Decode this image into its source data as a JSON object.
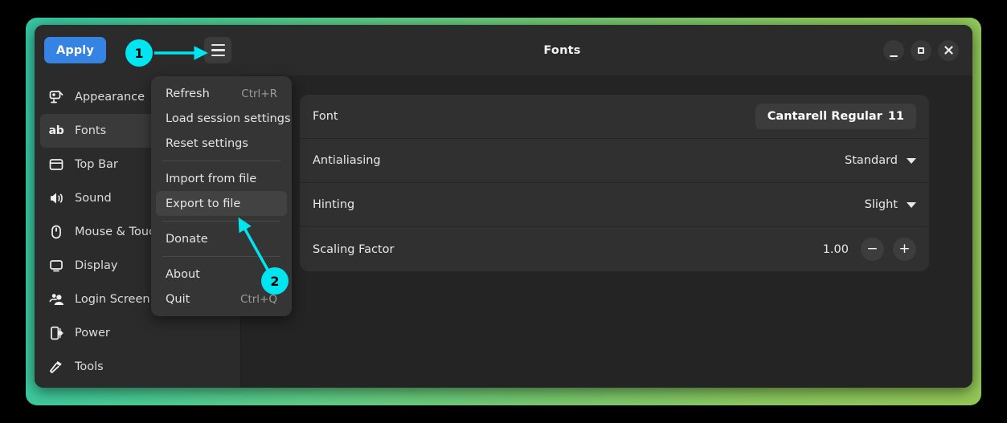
{
  "window": {
    "title": "Fonts",
    "controls": [
      {
        "name": "minimize",
        "glyph": "–"
      },
      {
        "name": "maximize",
        "glyph": "□"
      },
      {
        "name": "close",
        "glyph": "✕"
      }
    ]
  },
  "header": {
    "apply_label": "Apply",
    "menu_button_name": "hamburger-menu-icon"
  },
  "sidebar": {
    "items": [
      {
        "label": "Appearance",
        "icon": "appearance-icon",
        "selected": false
      },
      {
        "label": "Fonts",
        "icon": "ab-text-icon",
        "selected": true
      },
      {
        "label": "Top Bar",
        "icon": "top-bar-icon",
        "selected": false
      },
      {
        "label": "Sound",
        "icon": "speaker-icon",
        "selected": false
      },
      {
        "label": "Mouse & Touchpad",
        "icon": "mouse-icon",
        "selected": false
      },
      {
        "label": "Display",
        "icon": "monitor-icon",
        "selected": false
      },
      {
        "label": "Login Screen",
        "icon": "people-icon",
        "selected": false
      },
      {
        "label": "Power",
        "icon": "power-plug-icon",
        "selected": false
      },
      {
        "label": "Tools",
        "icon": "hammer-icon",
        "selected": false
      }
    ]
  },
  "menu": {
    "groups": [
      {
        "items": [
          {
            "label": "Refresh",
            "accel": "Ctrl+R",
            "highlighted": false
          },
          {
            "label": "Load session settings",
            "accel": "",
            "highlighted": false
          },
          {
            "label": "Reset settings",
            "accel": "",
            "highlighted": false
          }
        ]
      },
      {
        "items": [
          {
            "label": "Import from file",
            "accel": "",
            "highlighted": false
          },
          {
            "label": "Export to file",
            "accel": "",
            "highlighted": true
          }
        ]
      },
      {
        "items": [
          {
            "label": "Donate",
            "accel": "",
            "highlighted": false
          }
        ]
      },
      {
        "items": [
          {
            "label": "About",
            "accel": "",
            "highlighted": false
          },
          {
            "label": "Quit",
            "accel": "Ctrl+Q",
            "highlighted": false
          }
        ]
      }
    ]
  },
  "preferences": {
    "font": {
      "label": "Font",
      "family": "Cantarell Regular",
      "size": "11"
    },
    "antialiasing": {
      "label": "Antialiasing",
      "value": "Standard"
    },
    "hinting": {
      "label": "Hinting",
      "value": "Slight"
    },
    "scaling_factor": {
      "label": "Scaling Factor",
      "value": "1.00",
      "decrement": "−",
      "increment": "+"
    }
  },
  "annotations": {
    "markers": [
      {
        "number": "1",
        "target": "hamburger-menu-button"
      },
      {
        "number": "2",
        "target": "export-to-file-menu-item"
      }
    ],
    "accent_color": "#00e5f0"
  },
  "colors": {
    "accent_blue": "#3584e4",
    "annotation_cyan": "#00e5f0",
    "window_bg": "#242424",
    "header_bg": "#2b2b2b",
    "card_bg": "#303030",
    "menu_bg": "#353535",
    "gradient_start": "#35c7a4",
    "gradient_end": "#93c857"
  }
}
